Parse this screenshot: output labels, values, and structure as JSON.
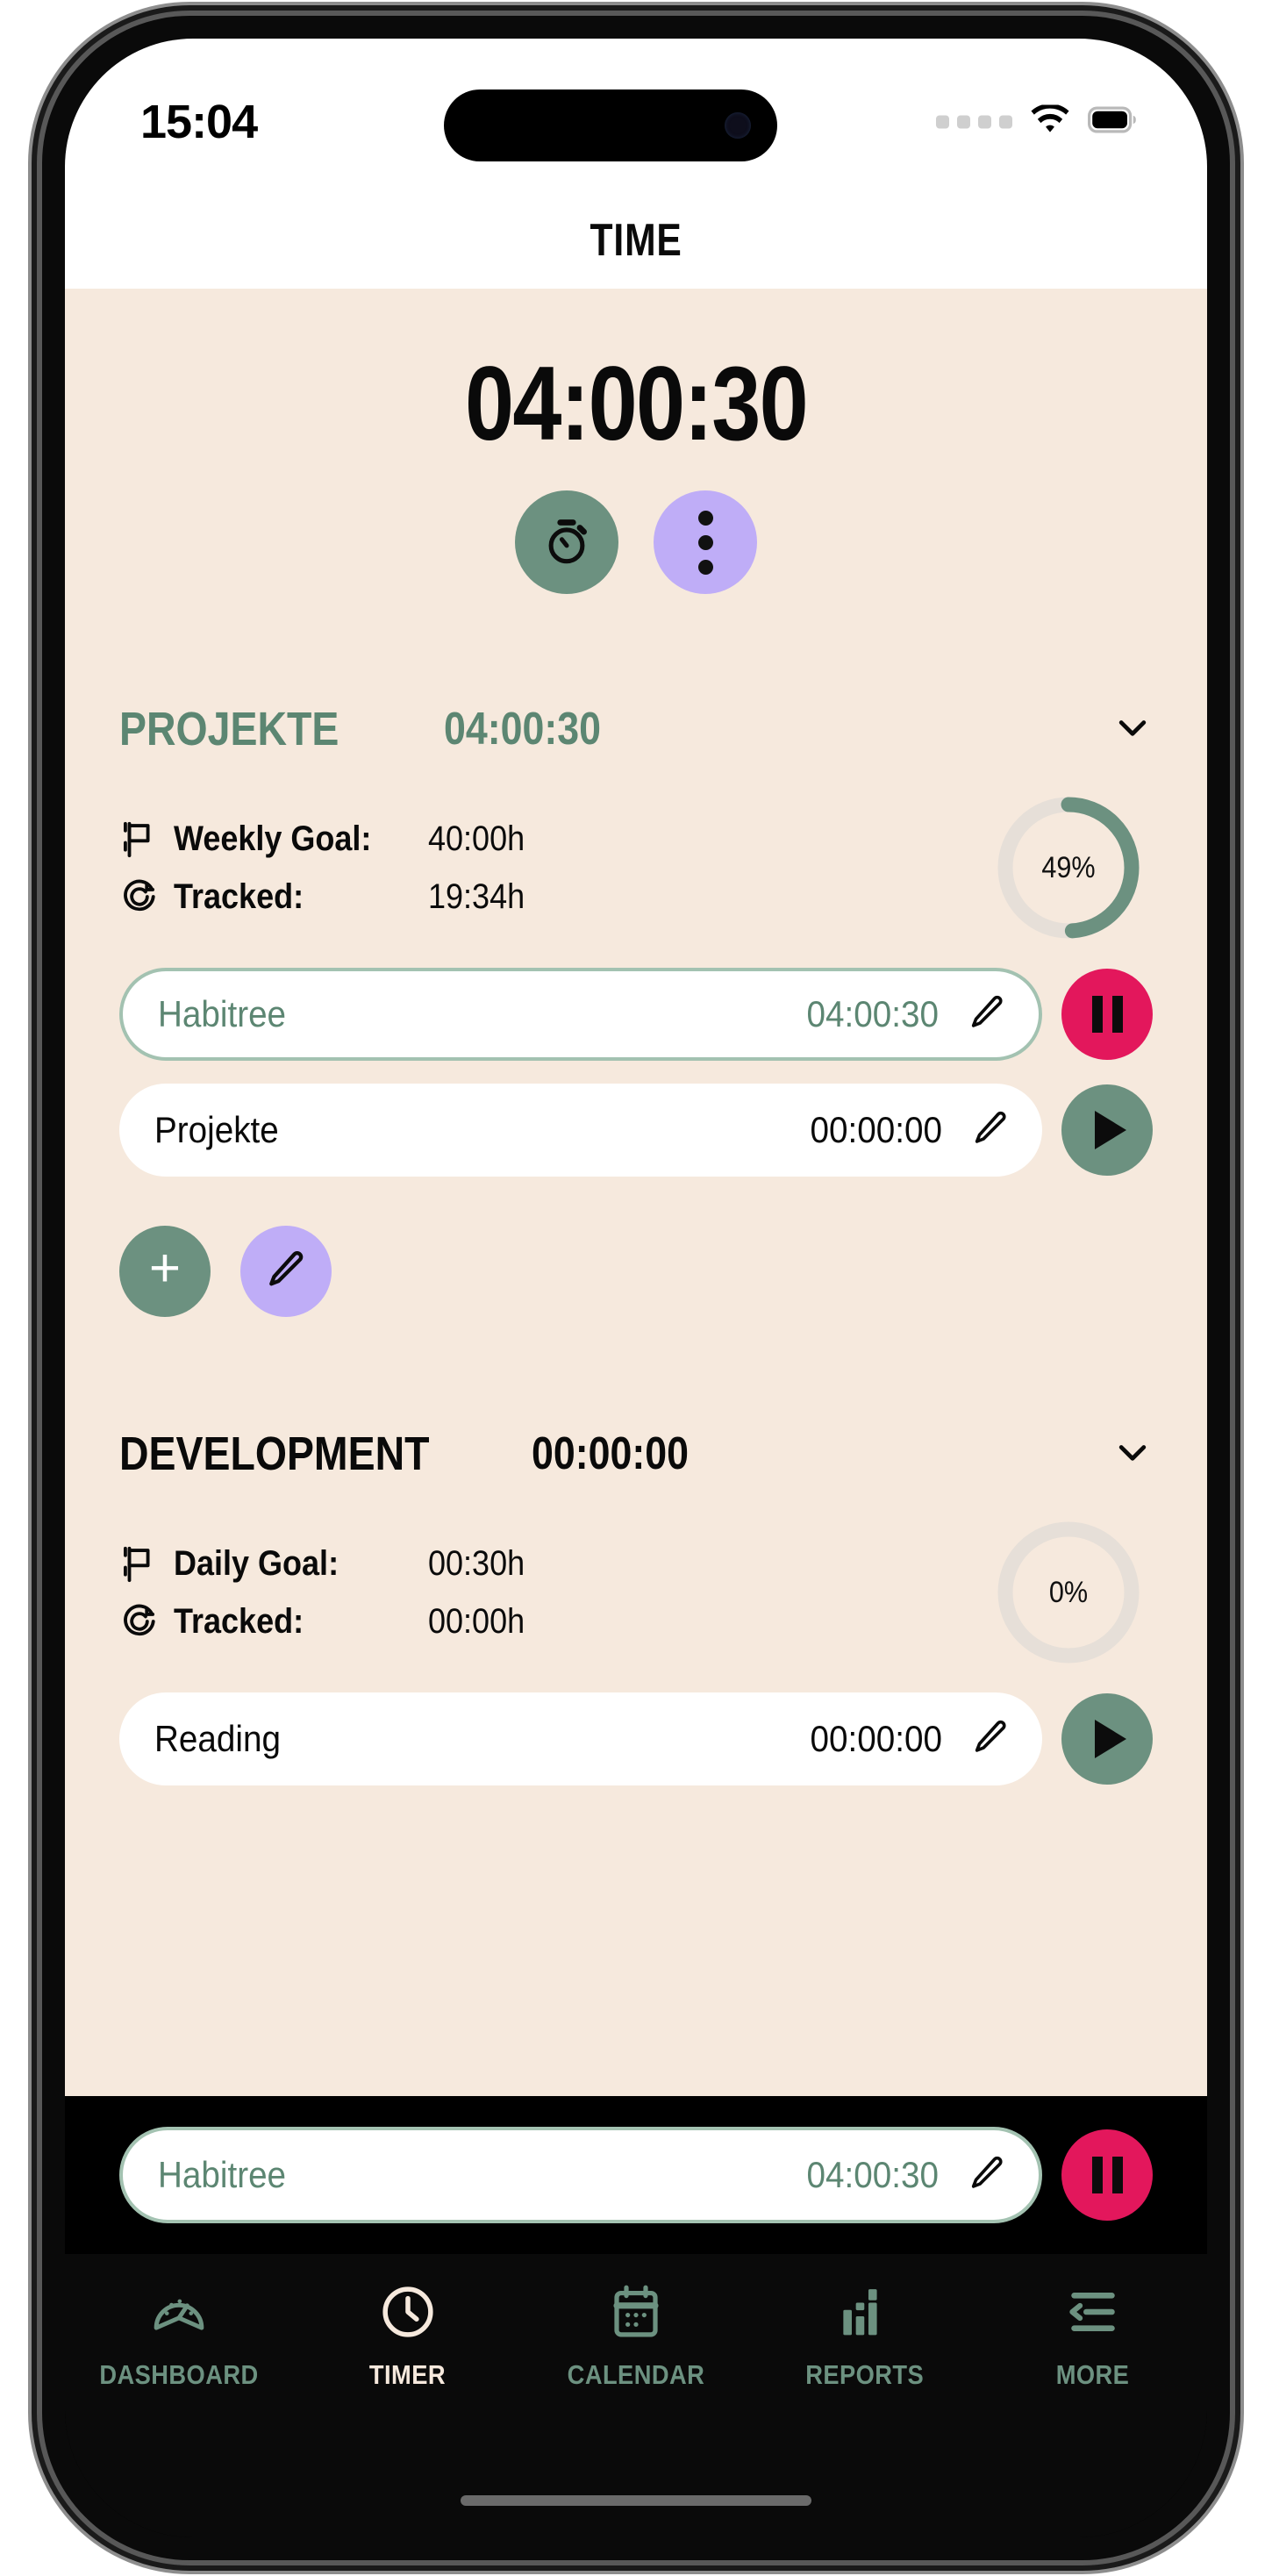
{
  "status_bar": {
    "time": "15:04",
    "signal_icon": "signal-dots-icon",
    "wifi_icon": "wifi-icon",
    "battery_icon": "battery-full-icon"
  },
  "header": {
    "title": "TIME"
  },
  "timer": {
    "elapsed": "04:00:30",
    "stopwatch_button_icon": "stopwatch-icon",
    "more_button_icon": "more-vertical-icon"
  },
  "colors": {
    "background": "#f6e9dd",
    "green": "#6c9180",
    "green_text": "#5c8672",
    "lavender": "#bfadf7",
    "pink": "#e3175c",
    "ring_track": "#e4ddd6",
    "dark": "#0a0a0a"
  },
  "sections": [
    {
      "name": "PROJEKTE",
      "total": "04:00:30",
      "name_color": "green",
      "collapse_icon": "chevron-down-icon",
      "goal_label": "Weekly Goal:",
      "goal_value": "40:00h",
      "goal_icon": "flag-icon",
      "tracked_label": "Tracked:",
      "tracked_value": "19:34h",
      "tracked_icon": "target-icon",
      "progress_percent": "49%",
      "progress_value": 49,
      "tasks": [
        {
          "name": "Habitree",
          "time": "04:00:30",
          "active": true,
          "edit_icon": "pencil-icon",
          "control_icon": "pause-icon"
        },
        {
          "name": "Projekte",
          "time": "00:00:00",
          "active": false,
          "edit_icon": "pencil-icon",
          "control_icon": "play-icon"
        }
      ],
      "add_button_icon": "plus-icon",
      "edit_button_icon": "pencil-icon"
    },
    {
      "name": "DEVELOPMENT",
      "total": "00:00:00",
      "name_color": "black",
      "collapse_icon": "chevron-down-icon",
      "goal_label": "Daily Goal:",
      "goal_value": "00:30h",
      "goal_icon": "flag-icon",
      "tracked_label": "Tracked:",
      "tracked_value": "00:00h",
      "tracked_icon": "target-icon",
      "progress_percent": "0%",
      "progress_value": 0,
      "tasks": [
        {
          "name": "Reading",
          "time": "00:00:00",
          "active": false,
          "edit_icon": "pencil-icon",
          "control_icon": "play-icon"
        }
      ]
    }
  ],
  "floating_bar": {
    "name": "Habitree",
    "time": "04:00:30",
    "edit_icon": "pencil-icon",
    "control_icon": "pause-icon"
  },
  "tab_bar": {
    "items": [
      {
        "label": "DASHBOARD",
        "icon": "gauge-icon",
        "active": false
      },
      {
        "label": "TIMER",
        "icon": "clock-icon",
        "active": true
      },
      {
        "label": "CALENDAR",
        "icon": "calendar-icon",
        "active": false
      },
      {
        "label": "REPORTS",
        "icon": "bar-chart-icon",
        "active": false
      },
      {
        "label": "MORE",
        "icon": "menu-arrow-icon",
        "active": false
      }
    ]
  }
}
